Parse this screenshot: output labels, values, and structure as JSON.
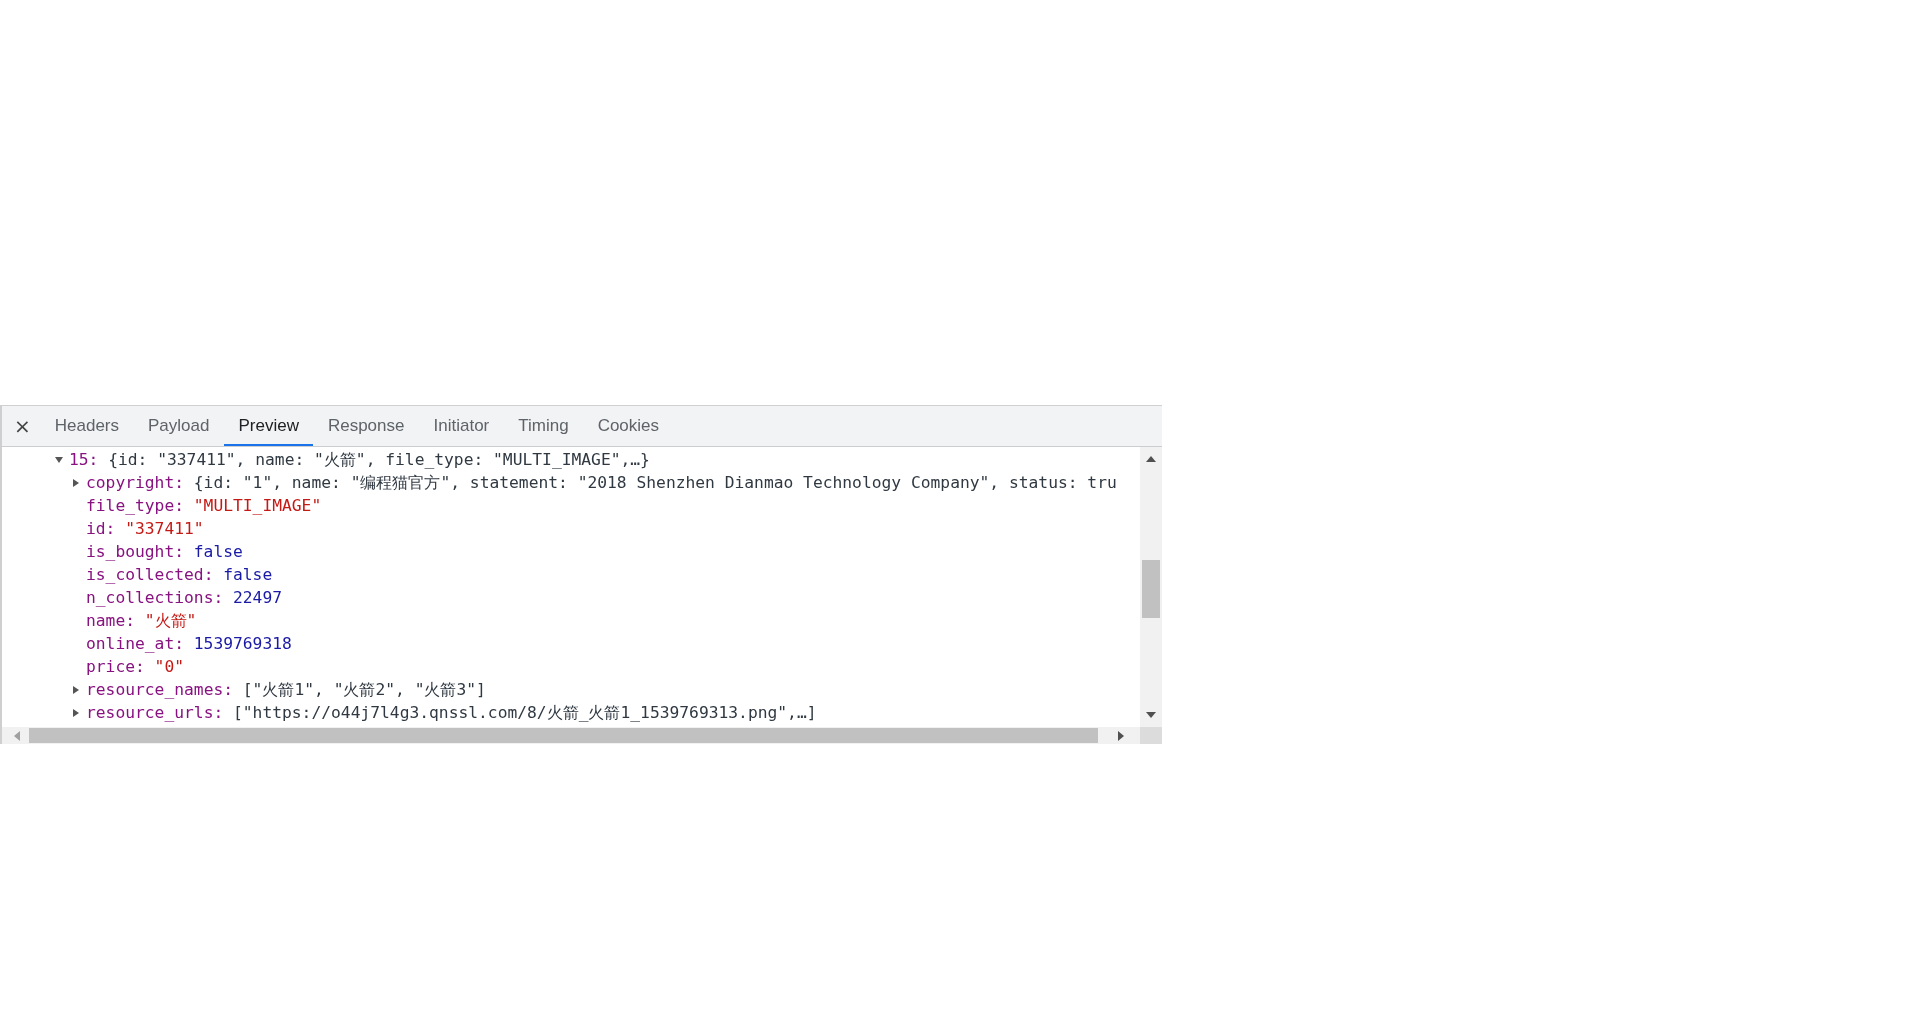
{
  "close_button": "×",
  "tabs": [
    {
      "label": "Headers",
      "selected": false
    },
    {
      "label": "Payload",
      "selected": false
    },
    {
      "label": "Preview",
      "selected": true
    },
    {
      "label": "Response",
      "selected": false
    },
    {
      "label": "Initiator",
      "selected": false
    },
    {
      "label": "Timing",
      "selected": false
    },
    {
      "label": "Cookies",
      "selected": false
    }
  ],
  "tree": [
    {
      "key": "15:",
      "value": "{id: \"337411\", name: \"火箭\", file_type: \"MULTI_IMAGE\",…}",
      "kind": "preview",
      "expanded": true,
      "children": [
        {
          "key": "copyright:",
          "value": "{id: \"1\", name: \"编程猫官方\", statement: \"2018 Shenzhen Dianmao Technology Company\", status: tru",
          "kind": "preview",
          "expanded": false
        },
        {
          "key": "file_type:",
          "value": "\"MULTI_IMAGE\"",
          "kind": "string"
        },
        {
          "key": "id:",
          "value": "\"337411\"",
          "kind": "string"
        },
        {
          "key": "is_bought:",
          "value": "false",
          "kind": "boolean"
        },
        {
          "key": "is_collected:",
          "value": "false",
          "kind": "boolean"
        },
        {
          "key": "n_collections:",
          "value": "22497",
          "kind": "number"
        },
        {
          "key": "name:",
          "value": "\"火箭\"",
          "kind": "string"
        },
        {
          "key": "online_at:",
          "value": "1539769318",
          "kind": "number"
        },
        {
          "key": "price:",
          "value": "\"0\"",
          "kind": "string"
        },
        {
          "key": "resource_names:",
          "value": "[\"火箭1\", \"火箭2\", \"火箭3\"]",
          "kind": "preview",
          "expanded": false
        },
        {
          "key": "resource_urls:",
          "value": "[\"https://o44j7l4g3.qnssl.com/8/火箭_火箭1_1539769313.png\",…]",
          "kind": "preview",
          "expanded": false
        }
      ]
    }
  ]
}
